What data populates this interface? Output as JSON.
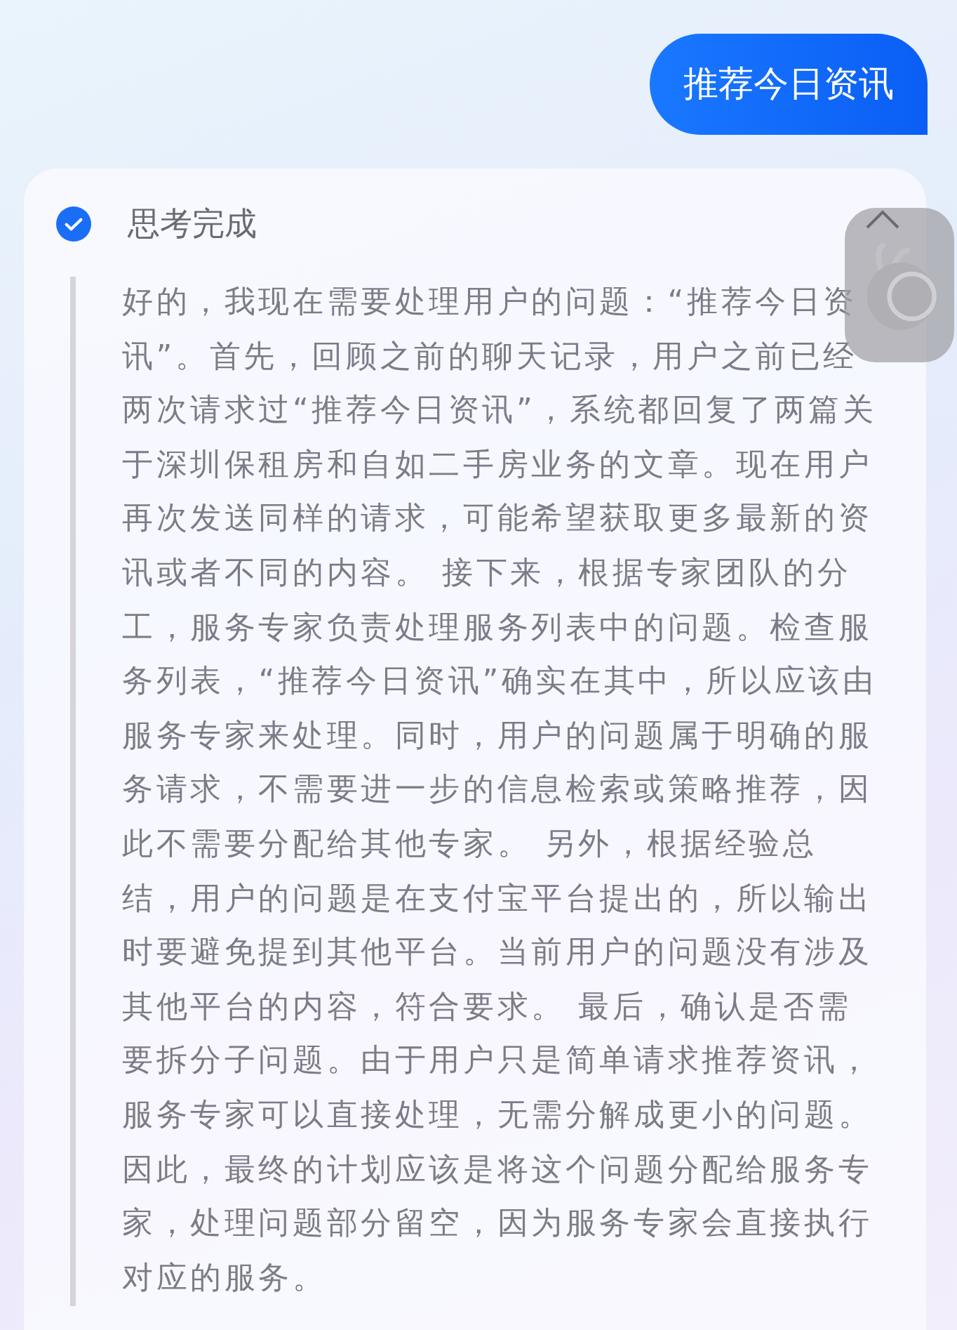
{
  "user_message": {
    "text": "推荐今日资讯"
  },
  "thinking": {
    "status": "思考完成",
    "completed": true,
    "expanded": true,
    "text": "好的，我现在需要处理用户的问题：“推荐今日资讯”。首先，回顾之前的聊天记录，用户之前已经两次请求过“推荐今日资讯”，系统都回复了两篇关于深圳保租房和自如二手房业务的文章。现在用户再次发送同样的请求，可能希望获取更多最新的资讯或者不同的内容。 接下来，根据专家团队的分工，服务专家负责处理服务列表中的问题。检查服务列表，“推荐今日资讯”确实在其中，所以应该由服务专家来处理。同时，用户的问题属于明确的服务请求，不需要进一步的信息检索或策略推荐，因此不需要分配给其他专家。 另外，根据经验总结，用户的问题是在支付宝平台提出的，所以输出时要避免提到其他平台。当前用户的问题没有涉及其他平台的内容，符合要求。 最后，确认是否需要拆分子问题。由于用户只是简单请求推荐资讯，服务专家可以直接处理，无需分解成更小的问题。因此，最终的计划应该是将这个问题分配给服务专家，处理问题部分留空，因为服务专家会直接执行对应的服务。"
  }
}
